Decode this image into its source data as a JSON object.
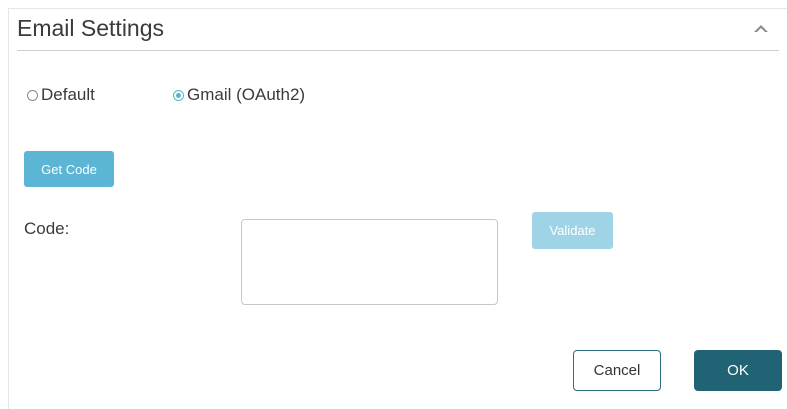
{
  "panel": {
    "title": "Email Settings",
    "collapse_icon": "chevron-up-icon"
  },
  "mail_type": {
    "options": [
      {
        "label": "Default",
        "selected": false
      },
      {
        "label": "Gmail (OAuth2)",
        "selected": true
      }
    ]
  },
  "actions": {
    "get_code_label": "Get Code",
    "validate_label": "Validate",
    "cancel_label": "Cancel",
    "ok_label": "OK"
  },
  "code_field": {
    "label": "Code:",
    "value": "",
    "placeholder": ""
  },
  "colors": {
    "accent": "#5bb5d5",
    "accent_disabled": "#9fd3e6",
    "primary": "#1f6374"
  }
}
